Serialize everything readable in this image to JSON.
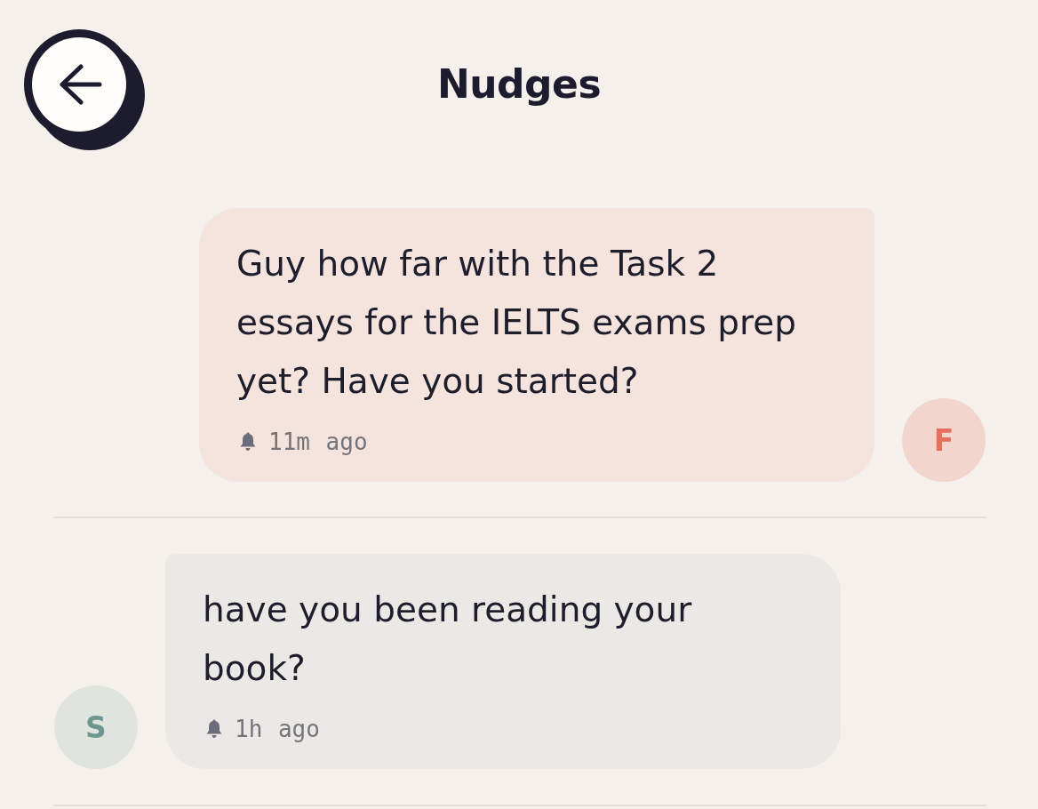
{
  "header": {
    "title": "Nudges"
  },
  "nudges": [
    {
      "kind": "sent",
      "avatar": "F",
      "text": "Guy how far with the Task 2 essays for the IELTS exams prep yet? Have you started?",
      "time": "11m ago"
    },
    {
      "kind": "received",
      "avatar": "S",
      "text": "have you been reading your book?",
      "time": "1h ago"
    }
  ]
}
